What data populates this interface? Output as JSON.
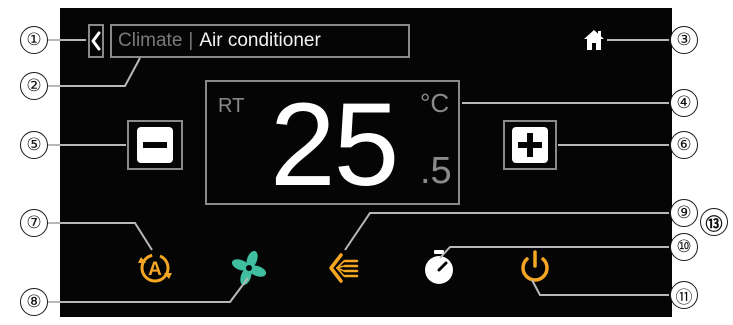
{
  "header": {
    "section_label": "Climate",
    "separator": "|",
    "device_label": "Air conditioner"
  },
  "display": {
    "rt_label": "RT",
    "temperature_integer": "25",
    "temperature_decimal": ".5",
    "unit": "°C"
  },
  "callouts": [
    "①",
    "②",
    "③",
    "④",
    "⑤",
    "⑥",
    "⑦",
    "⑧",
    "⑨",
    "⑩",
    "⑪",
    "⑬"
  ],
  "icons": {
    "back": "chevron-left-icon",
    "home": "home-icon",
    "minus": "minus-icon",
    "plus": "plus-icon",
    "mode": "auto-mode-icon",
    "fan": "fan-icon",
    "swing": "swing-icon",
    "timer": "timer-icon",
    "power": "power-icon"
  },
  "colors": {
    "background": "#050505",
    "frame": "#8a8a8a",
    "text_primary": "#ffffff",
    "text_secondary": "#7a7a7a",
    "accent_orange": "#f5a623",
    "fan_teal": "#3fbfa0",
    "timer_white": "#ffffff"
  }
}
